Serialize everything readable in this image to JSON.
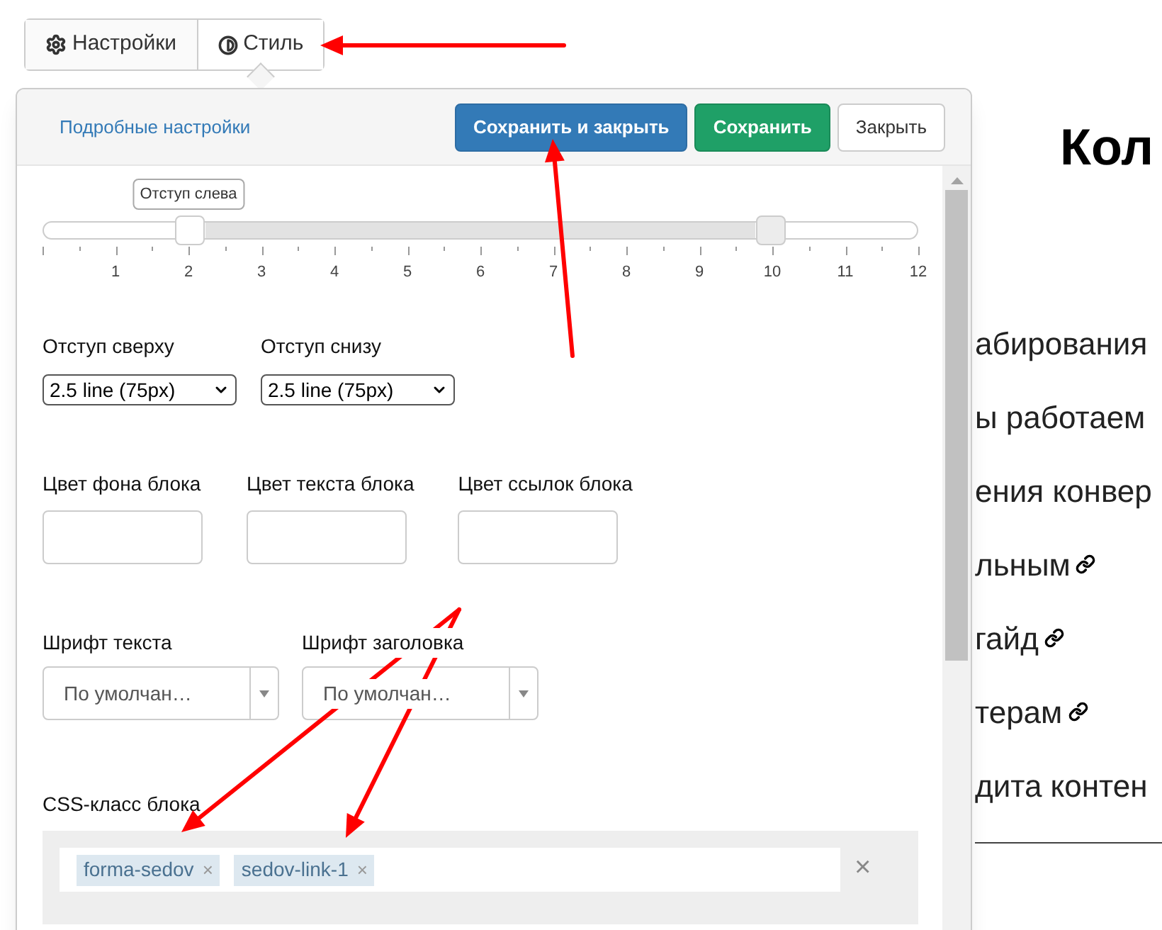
{
  "tabs": [
    {
      "label": "Настройки",
      "selected": false
    },
    {
      "label": "Стиль",
      "selected": true
    }
  ],
  "popover": {
    "link": "Подробные настройки",
    "buttons": [
      {
        "label": "Сохранить и закрыть",
        "kind": "primary"
      },
      {
        "label": "Сохранить",
        "kind": "success"
      },
      {
        "label": "Закрыть",
        "kind": "default"
      }
    ]
  },
  "slider": {
    "tooltip": "Отступ слева",
    "thumbs": [
      {
        "level": 0.1667
      },
      {
        "level": 0.8333
      }
    ],
    "ticks": [
      "1",
      "2",
      "3",
      "4",
      "5",
      "6",
      "7",
      "8",
      "9",
      "10",
      "11",
      "12"
    ]
  },
  "spacing": [
    {
      "label": "Отступ сверху",
      "value": "2.5 line (75px)"
    },
    {
      "label": "Отступ снизу",
      "value": "2.5 line (75px)"
    }
  ],
  "colors": [
    {
      "label": "Цвет фона блока"
    },
    {
      "label": "Цвет текста блока"
    },
    {
      "label": "Цвет ссылок блока"
    }
  ],
  "fonts": [
    {
      "label": "Шрифт текста",
      "value": "По умолчан…"
    },
    {
      "label": "Шрифт заголовка",
      "value": "По умолчан…"
    }
  ],
  "css_class": {
    "label": "CSS-класс блока",
    "tags": [
      "forma-sedov",
      "sedov-link-1"
    ],
    "clear": "×",
    "remove": "×"
  },
  "page": {
    "heading": "Кол",
    "lines": [
      {
        "text": "абирования",
        "link": false
      },
      {
        "text": "ы работаем",
        "link": false
      },
      {
        "text": "ения конвер",
        "link": false
      },
      {
        "text": "льным",
        "link": true
      },
      {
        "text": "гайд",
        "link": true
      },
      {
        "text": "терам",
        "link": true
      },
      {
        "text": "дита контен",
        "link": false
      }
    ]
  }
}
